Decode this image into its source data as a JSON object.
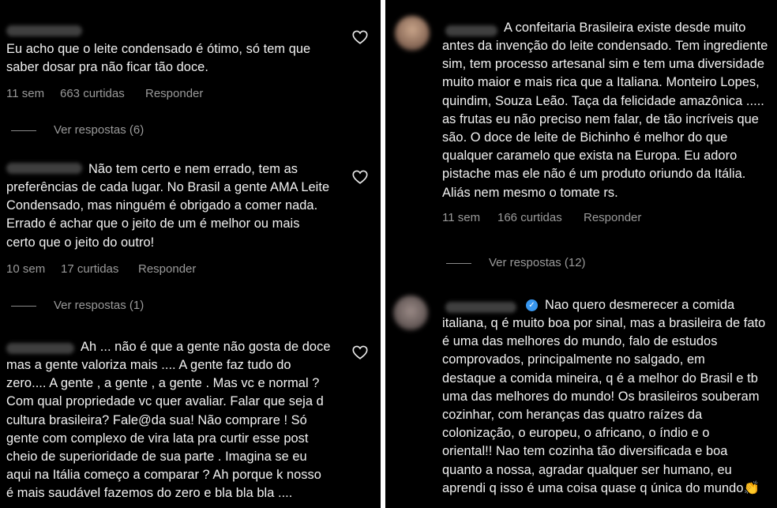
{
  "left": {
    "comments": [
      {
        "text": "Eu acho que o leite condensado é ótimo, só tem que\nsaber dosar pra não ficar tão doce.",
        "time": "11 sem",
        "likes": "663 curtidas",
        "reply_label": "Responder",
        "view_replies": "Ver respostas (6)"
      },
      {
        "text_first": "Não tem certo e nem errado, tem as",
        "text": "preferências de cada lugar. No Brasil a gente AMA Leite\nCondensado, mas ninguém é obrigado a comer nada.\nErrado é achar que o jeito de um é melhor ou mais\ncerto que o jeito do outro!",
        "time": "10 sem",
        "likes": "17 curtidas",
        "reply_label": "Responder",
        "view_replies": "Ver respostas (1)"
      },
      {
        "text_first": "Ah ... não é que a gente não gosta de doce",
        "text": "mas a gente valoriza mais .... A gente faz tudo do\nzero.... A gente , a gente , a gente . Mas vc e normal ?\nCom qual propriedade vc quer avaliar. Falar que seja d\ncultura brasileira? Fale@da sua! Não comprare ! Só\ngente com complexo de vira lata pra curtir esse post\ncheio de superioridade de sua parte . Imagina se eu\naqui na Itália começo a comparar ? Ah porque k nosso\né mais saudável fazemos do zero e bla bla bla ...."
      }
    ]
  },
  "right": {
    "comments": [
      {
        "text_first": "A confeitaria Brasileira existe desde muito",
        "text": "antes da invenção do leite condensado. Tem ingrediente\nsim, tem processo artesanal sim e tem uma diversidade\nmuito maior e mais rica que a Italiana. Monteiro Lopes,\nquindim, Souza Leão. Taça da felicidade amazônica .....\nas frutas eu não preciso nem falar, de tão incríveis que\nsão. O doce de leite de Bichinho é melhor do que\nqualquer caramelo que exista na Europa. Eu adoro\npistache mas ele não é um produto oriundo da Itália.\nAliás nem mesmo o tomate rs.",
        "time": "11 sem",
        "likes": "166 curtidas",
        "reply_label": "Responder",
        "view_replies": "Ver respostas (12)"
      },
      {
        "text_first": "Nao quero desmerecer a comida",
        "text": "italiana, q é muito boa por sinal, mas a brasileira de fato\né uma das melhores do mundo, falo de estudos\ncomprovados, principalmente no salgado, em\ndestaque a comida mineira, q é a melhor do Brasil e tb\numa das melhores do mundo! Os brasileiros souberam\ncozinhar, com heranças das quatro raízes da\ncolonização, o europeu, o africano, o índio e o\noriental!! Nao tem cozinha tão diversificada e boa\nquanto a nossa, agradar qualquer ser humano, eu\naprendi q isso é uma coisa quase q única do mundo",
        "emoji": "👏"
      }
    ]
  },
  "icons": [
    "heart-icon",
    "verified-badge-icon"
  ],
  "colors": {
    "background": "#000000",
    "text": "#f2f2f2",
    "muted": "#9a9a9a",
    "verified": "#3897f0",
    "divider": "#ffffff"
  }
}
